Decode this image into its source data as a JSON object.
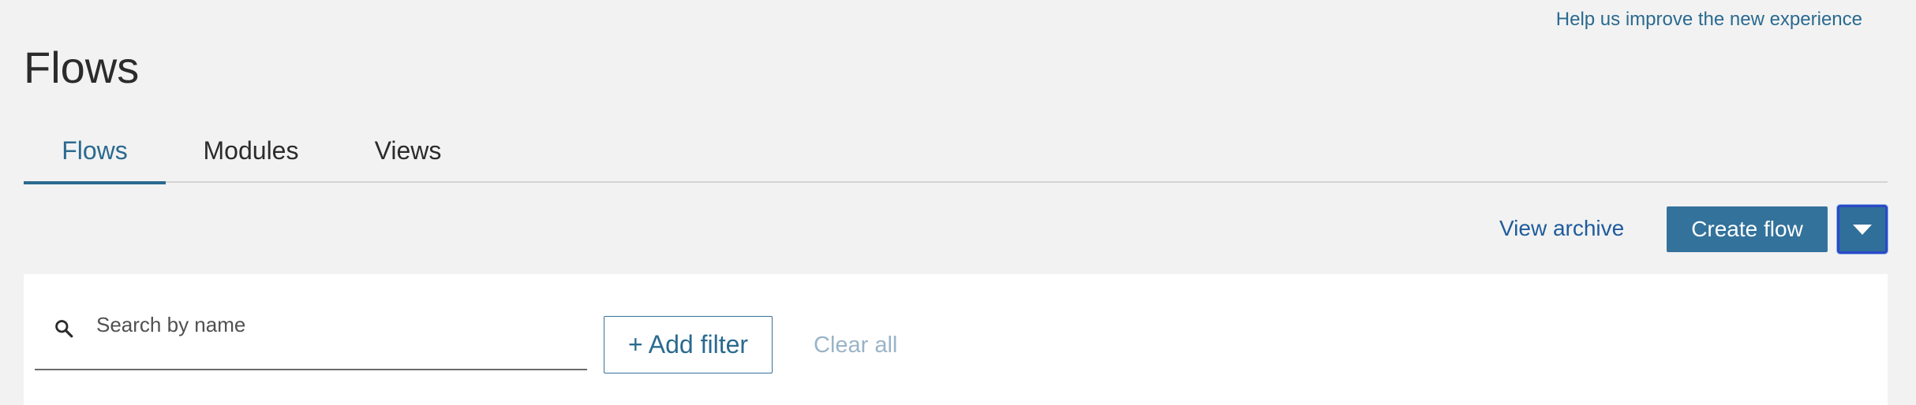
{
  "header": {
    "help_link": "Help us improve the new experience",
    "title": "Flows"
  },
  "tabs": [
    {
      "label": "Flows",
      "active": true
    },
    {
      "label": "Modules",
      "active": false
    },
    {
      "label": "Views",
      "active": false
    }
  ],
  "toolbar": {
    "view_archive_label": "View archive",
    "create_flow_label": "Create flow",
    "dropdown_icon": "chevron-down-icon"
  },
  "filters": {
    "search_placeholder": "Search by name",
    "search_value": "",
    "search_icon": "search-icon",
    "add_filter_label": "+ Add filter",
    "clear_all_label": "Clear all"
  },
  "colors": {
    "background": "#f2f2f2",
    "accent": "#2a6a8f",
    "primary_button": "#33729b",
    "focus_ring": "#2b49c6",
    "link": "#1f5c9c",
    "disabled_link": "#9ab4c8"
  }
}
